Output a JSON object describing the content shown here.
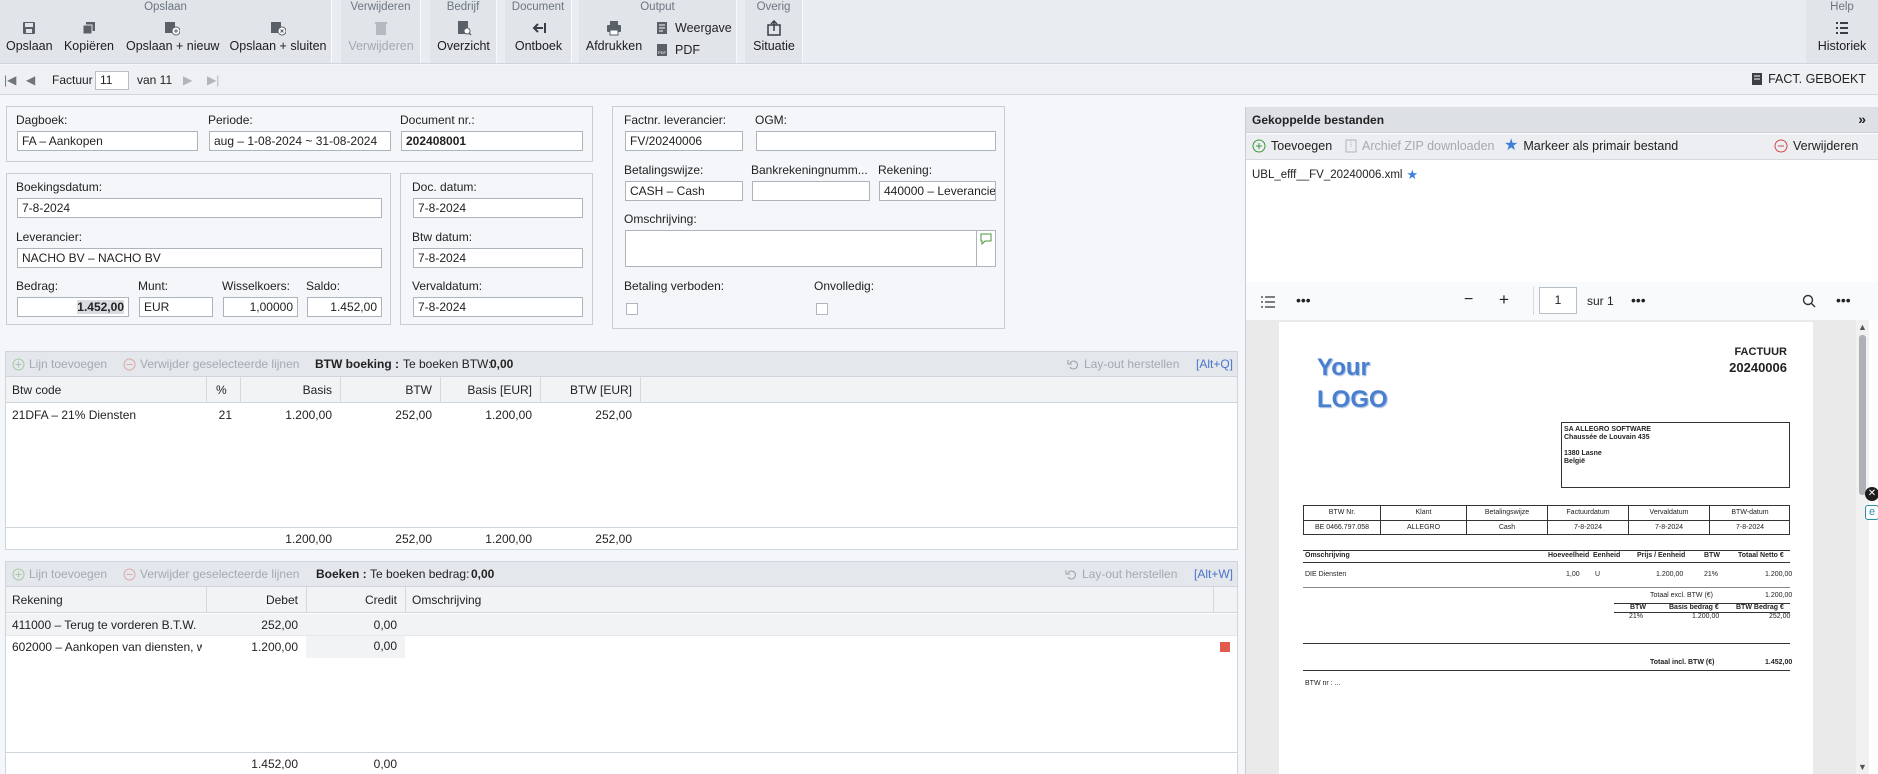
{
  "ribbon": {
    "groups": {
      "opslaan": "Opslaan",
      "verwijderen": "Verwijderen",
      "bedrijf": "Bedrijf",
      "document": "Document",
      "output": "Output",
      "overig": "Overig",
      "help": "Help"
    },
    "buttons": {
      "opslaan": "Opslaan",
      "kopieren": "Kopiëren",
      "opslaan_nieuw": "Opslaan + nieuw",
      "opslaan_sluiten": "Opslaan + sluiten",
      "verwijderen": "Verwijderen",
      "overzicht": "Overzicht",
      "ontboek": "Ontboek",
      "afdrukken": "Afdrukken",
      "weergave": "Weergave",
      "pdf": "PDF",
      "situatie": "Situatie",
      "historiek": "Historiek"
    }
  },
  "nav": {
    "label": "Factuur",
    "current": "11",
    "of_label": "van 11",
    "status": "FACT. GEBOEKT"
  },
  "form": {
    "dagboek_label": "Dagboek:",
    "dagboek": "FA – Aankopen",
    "periode_label": "Periode:",
    "periode": "aug – 1-08-2024 ~ 31-08-2024",
    "docnr_label": "Document nr.:",
    "docnr": "202408001",
    "boekingsdatum_label": "Boekingsdatum:",
    "boekingsdatum": "7-8-2024",
    "leverancier_label": "Leverancier:",
    "leverancier": "NACHO BV – NACHO BV",
    "bedrag_label": "Bedrag:",
    "bedrag": "1.452,00",
    "munt_label": "Munt:",
    "munt": "EUR",
    "wisselkoers_label": "Wisselkoers:",
    "wisselkoers": "1,00000",
    "saldo_label": "Saldo:",
    "saldo": "1.452,00",
    "docdatum_label": "Doc. datum:",
    "docdatum": "7-8-2024",
    "btwdatum_label": "Btw datum:",
    "btwdatum": "7-8-2024",
    "vervaldatum_label": "Vervaldatum:",
    "vervaldatum": "7-8-2024",
    "factnr_label": "Factnr. leverancier:",
    "factnr": "FV/20240006",
    "ogm_label": "OGM:",
    "ogm": "",
    "betalingswijze_label": "Betalingswijze:",
    "betalingswijze": "CASH – Cash",
    "bankrek_label": "Bankrekeningnumm...",
    "bankrek": "",
    "rekening_label": "Rekening:",
    "rekening": "440000 – Leverancie",
    "omschrijving_label": "Omschrijving:",
    "omschrijving": "",
    "betaling_verboden_label": "Betaling verboden:",
    "onvolledig_label": "Onvolledig:"
  },
  "btw_grid": {
    "add": "Lijn toevoegen",
    "delete": "Verwijder geselecteerde lijnen",
    "title": "BTW boeking :",
    "to_book_label": "Te boeken BTW:",
    "to_book": "0,00",
    "reset": "Lay-out herstellen",
    "shortcut": "[Alt+Q]",
    "columns": [
      "Btw code",
      "%",
      "Basis",
      "BTW",
      "Basis [EUR]",
      "BTW [EUR]"
    ],
    "rows": [
      [
        "21DFA – 21% Diensten",
        "21",
        "1.200,00",
        "252,00",
        "1.200,00",
        "252,00"
      ]
    ],
    "totals": [
      "1.200,00",
      "252,00",
      "1.200,00",
      "252,00"
    ]
  },
  "boek_grid": {
    "add": "Lijn toevoegen",
    "delete": "Verwijder geselecteerde lijnen",
    "title": "Boeken :",
    "to_book_label": "Te boeken bedrag:",
    "to_book": "0,00",
    "reset": "Lay-out herstellen",
    "shortcut": "[Alt+W]",
    "columns": [
      "Rekening",
      "Debet",
      "Credit",
      "Omschrijving"
    ],
    "rows": [
      [
        "411000 – Terug te vorderen B.T.W.",
        "252,00",
        "0,00",
        ""
      ],
      [
        "602000 – Aankopen van diensten, w...",
        "1.200,00",
        "0,00",
        ""
      ]
    ],
    "totals": [
      "1.452,00",
      "0,00"
    ]
  },
  "files_panel": {
    "title": "Gekoppelde bestanden",
    "add": "Toevoegen",
    "zip": "Archief ZIP downloaden",
    "primary": "Markeer als primair bestand",
    "delete": "Verwijderen",
    "file": "UBL_efff__FV_20240006.xml",
    "page": "1",
    "page_of": "sur 1"
  },
  "invoice": {
    "logo1": "Your",
    "logo2": "LOGO",
    "doc_type": "FACTUUR",
    "doc_nr": "20240006",
    "addr1": "SA ALLEGRO SOFTWARE",
    "addr2": "Chaussée de Louvain 435",
    "addr3": "1380 Lasne",
    "addr4": "België",
    "head_cols": [
      "BTW Nr.",
      "Klant",
      "Betalingswijze",
      "Factuurdatum",
      "Vervaldatum",
      "BTW-datum"
    ],
    "head_vals": [
      "BE 0466.797.058",
      "ALLEGRO",
      "Cash",
      "7-8-2024",
      "7-8-2024",
      "7-8-2024"
    ],
    "line_cols": [
      "Omschrijving",
      "Hoeveelheid",
      "Eenheid",
      "Prijs / Eenheid",
      "BTW",
      "Totaal Netto €"
    ],
    "line_vals": [
      "DIE  Diensten",
      "1,00",
      "U",
      "1.200,00",
      "21%",
      "1.200,00"
    ],
    "total_excl_label": "Totaal excl. BTW (€)",
    "total_excl": "1.200,00",
    "vat_cols": [
      "BTW",
      "Basis bedrag €",
      "BTW Bedrag €"
    ],
    "vat_vals": [
      "21%",
      "1.200,00",
      "252,00"
    ],
    "total_incl_label": "Totaal incl. BTW (€)",
    "total_incl": "1.452,00",
    "btw_nr": "BTW nr : ..."
  },
  "colors": {
    "accent": "#4a74c9",
    "add_green": "#3a9a3a",
    "delete_red": "#d24b4b"
  }
}
